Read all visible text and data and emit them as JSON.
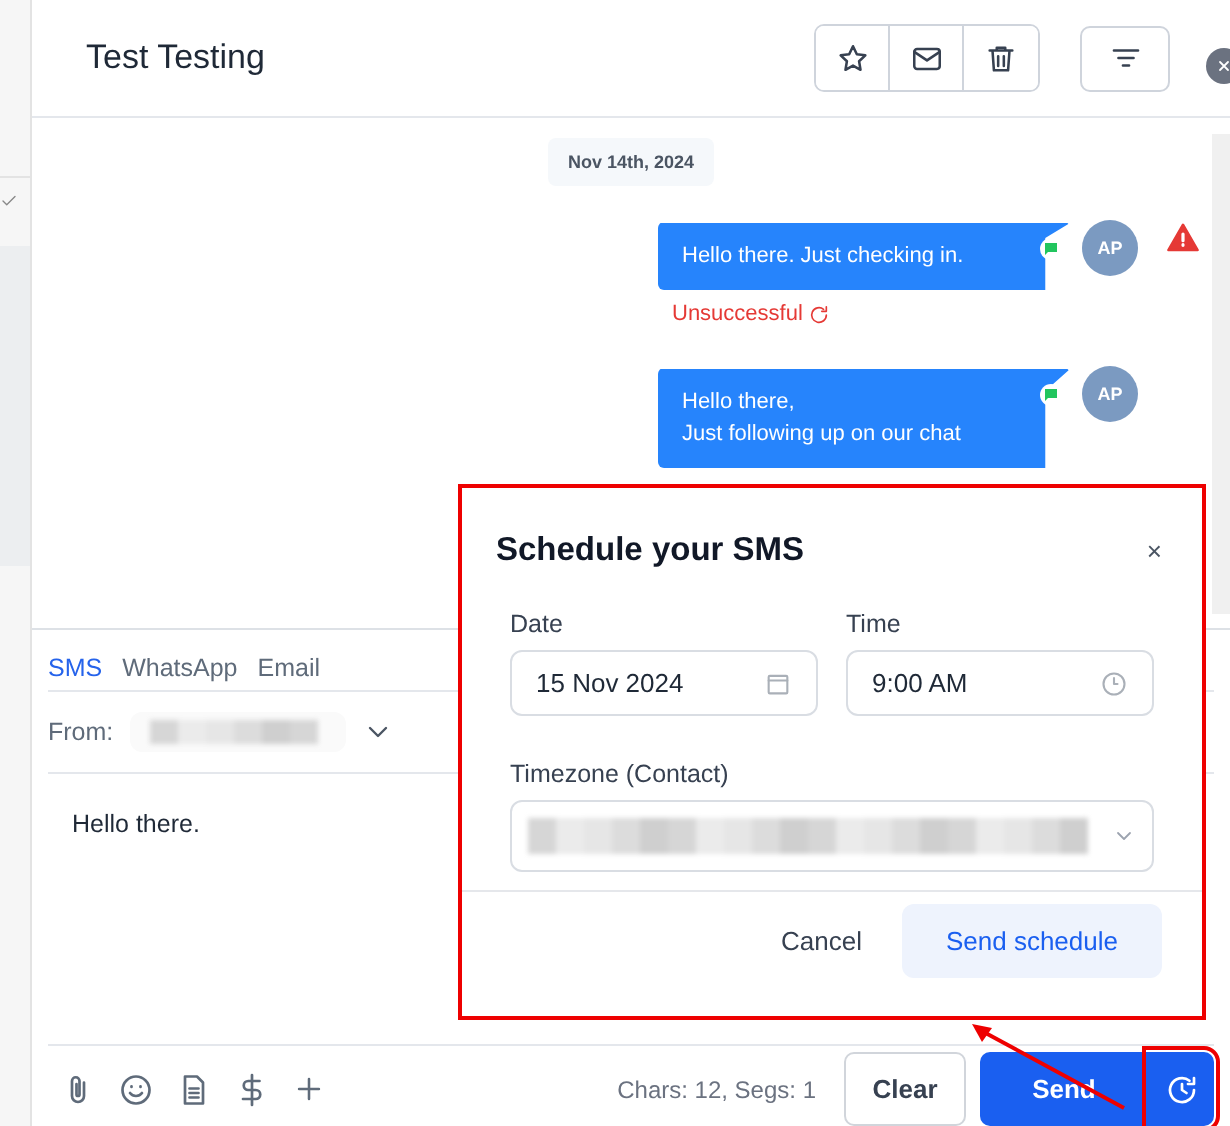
{
  "header": {
    "title": "Test Testing"
  },
  "thread": {
    "date": "Nov 14th, 2024",
    "messages": [
      {
        "lines": [
          "Hello there. Just checking in."
        ],
        "avatar": "AP",
        "failed": true,
        "status": "Unsuccessful"
      },
      {
        "lines": [
          "Hello there,",
          "Just following up on our chat"
        ],
        "avatar": "AP",
        "failed": false
      }
    ]
  },
  "composer": {
    "channels": [
      {
        "label": "SMS",
        "selected": true
      },
      {
        "label": "WhatsApp",
        "selected": false
      },
      {
        "label": "Email",
        "selected": false
      }
    ],
    "from_label": "From:",
    "message": "Hello there.",
    "counter": "Chars: 12, Segs: 1",
    "clear": "Clear",
    "send": "Send"
  },
  "dialog": {
    "title": "Schedule your SMS",
    "close": "×",
    "date_label": "Date",
    "date_value": "15 Nov 2024",
    "time_label": "Time",
    "time_value": "9:00 AM",
    "timezone_label": "Timezone (Contact)",
    "cancel": "Cancel",
    "confirm": "Send schedule"
  }
}
